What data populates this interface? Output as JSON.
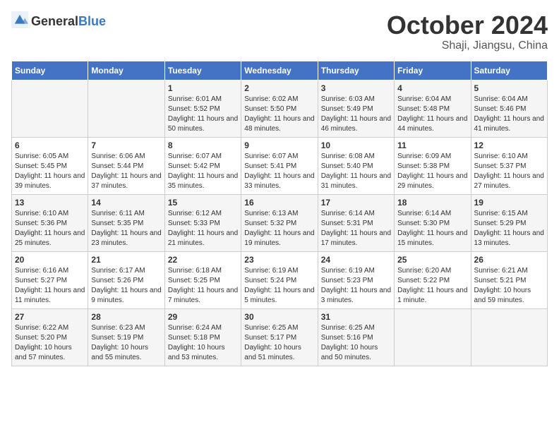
{
  "header": {
    "logo_general": "General",
    "logo_blue": "Blue",
    "month": "October 2024",
    "location": "Shaji, Jiangsu, China"
  },
  "days_of_week": [
    "Sunday",
    "Monday",
    "Tuesday",
    "Wednesday",
    "Thursday",
    "Friday",
    "Saturday"
  ],
  "weeks": [
    [
      {
        "day": "",
        "info": ""
      },
      {
        "day": "",
        "info": ""
      },
      {
        "day": "1",
        "info": "Sunrise: 6:01 AM\nSunset: 5:52 PM\nDaylight: 11 hours and 50 minutes."
      },
      {
        "day": "2",
        "info": "Sunrise: 6:02 AM\nSunset: 5:50 PM\nDaylight: 11 hours and 48 minutes."
      },
      {
        "day": "3",
        "info": "Sunrise: 6:03 AM\nSunset: 5:49 PM\nDaylight: 11 hours and 46 minutes."
      },
      {
        "day": "4",
        "info": "Sunrise: 6:04 AM\nSunset: 5:48 PM\nDaylight: 11 hours and 44 minutes."
      },
      {
        "day": "5",
        "info": "Sunrise: 6:04 AM\nSunset: 5:46 PM\nDaylight: 11 hours and 41 minutes."
      }
    ],
    [
      {
        "day": "6",
        "info": "Sunrise: 6:05 AM\nSunset: 5:45 PM\nDaylight: 11 hours and 39 minutes."
      },
      {
        "day": "7",
        "info": "Sunrise: 6:06 AM\nSunset: 5:44 PM\nDaylight: 11 hours and 37 minutes."
      },
      {
        "day": "8",
        "info": "Sunrise: 6:07 AM\nSunset: 5:42 PM\nDaylight: 11 hours and 35 minutes."
      },
      {
        "day": "9",
        "info": "Sunrise: 6:07 AM\nSunset: 5:41 PM\nDaylight: 11 hours and 33 minutes."
      },
      {
        "day": "10",
        "info": "Sunrise: 6:08 AM\nSunset: 5:40 PM\nDaylight: 11 hours and 31 minutes."
      },
      {
        "day": "11",
        "info": "Sunrise: 6:09 AM\nSunset: 5:38 PM\nDaylight: 11 hours and 29 minutes."
      },
      {
        "day": "12",
        "info": "Sunrise: 6:10 AM\nSunset: 5:37 PM\nDaylight: 11 hours and 27 minutes."
      }
    ],
    [
      {
        "day": "13",
        "info": "Sunrise: 6:10 AM\nSunset: 5:36 PM\nDaylight: 11 hours and 25 minutes."
      },
      {
        "day": "14",
        "info": "Sunrise: 6:11 AM\nSunset: 5:35 PM\nDaylight: 11 hours and 23 minutes."
      },
      {
        "day": "15",
        "info": "Sunrise: 6:12 AM\nSunset: 5:33 PM\nDaylight: 11 hours and 21 minutes."
      },
      {
        "day": "16",
        "info": "Sunrise: 6:13 AM\nSunset: 5:32 PM\nDaylight: 11 hours and 19 minutes."
      },
      {
        "day": "17",
        "info": "Sunrise: 6:14 AM\nSunset: 5:31 PM\nDaylight: 11 hours and 17 minutes."
      },
      {
        "day": "18",
        "info": "Sunrise: 6:14 AM\nSunset: 5:30 PM\nDaylight: 11 hours and 15 minutes."
      },
      {
        "day": "19",
        "info": "Sunrise: 6:15 AM\nSunset: 5:29 PM\nDaylight: 11 hours and 13 minutes."
      }
    ],
    [
      {
        "day": "20",
        "info": "Sunrise: 6:16 AM\nSunset: 5:27 PM\nDaylight: 11 hours and 11 minutes."
      },
      {
        "day": "21",
        "info": "Sunrise: 6:17 AM\nSunset: 5:26 PM\nDaylight: 11 hours and 9 minutes."
      },
      {
        "day": "22",
        "info": "Sunrise: 6:18 AM\nSunset: 5:25 PM\nDaylight: 11 hours and 7 minutes."
      },
      {
        "day": "23",
        "info": "Sunrise: 6:19 AM\nSunset: 5:24 PM\nDaylight: 11 hours and 5 minutes."
      },
      {
        "day": "24",
        "info": "Sunrise: 6:19 AM\nSunset: 5:23 PM\nDaylight: 11 hours and 3 minutes."
      },
      {
        "day": "25",
        "info": "Sunrise: 6:20 AM\nSunset: 5:22 PM\nDaylight: 11 hours and 1 minute."
      },
      {
        "day": "26",
        "info": "Sunrise: 6:21 AM\nSunset: 5:21 PM\nDaylight: 10 hours and 59 minutes."
      }
    ],
    [
      {
        "day": "27",
        "info": "Sunrise: 6:22 AM\nSunset: 5:20 PM\nDaylight: 10 hours and 57 minutes."
      },
      {
        "day": "28",
        "info": "Sunrise: 6:23 AM\nSunset: 5:19 PM\nDaylight: 10 hours and 55 minutes."
      },
      {
        "day": "29",
        "info": "Sunrise: 6:24 AM\nSunset: 5:18 PM\nDaylight: 10 hours and 53 minutes."
      },
      {
        "day": "30",
        "info": "Sunrise: 6:25 AM\nSunset: 5:17 PM\nDaylight: 10 hours and 51 minutes."
      },
      {
        "day": "31",
        "info": "Sunrise: 6:25 AM\nSunset: 5:16 PM\nDaylight: 10 hours and 50 minutes."
      },
      {
        "day": "",
        "info": ""
      },
      {
        "day": "",
        "info": ""
      }
    ]
  ]
}
